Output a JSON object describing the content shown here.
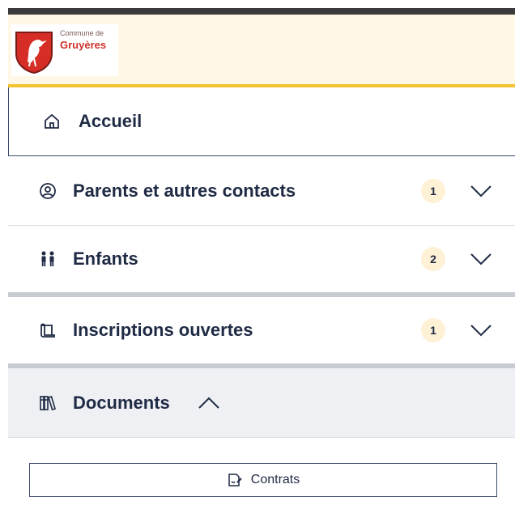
{
  "header": {
    "logo_small": "Commune de",
    "logo_name": "Gruyères"
  },
  "nav": {
    "accueil": {
      "label": "Accueil",
      "icon": "home-icon"
    },
    "parents": {
      "label": "Parents et autres contacts",
      "count": "1",
      "icon": "user-circle-icon"
    },
    "enfants": {
      "label": "Enfants",
      "count": "2",
      "icon": "children-icon"
    },
    "inscriptions": {
      "label": "Inscriptions ouvertes",
      "count": "1",
      "icon": "scroll-icon"
    },
    "documents": {
      "label": "Documents",
      "icon": "books-icon",
      "expanded": true
    }
  },
  "documents_panel": {
    "contrats_label": "Contrats",
    "contrats_icon": "contract-sign-icon"
  },
  "colors": {
    "header_bg": "#fff8e6",
    "header_border": "#f2c230",
    "badge_bg": "#fff1d6",
    "text": "#1f2a44"
  }
}
